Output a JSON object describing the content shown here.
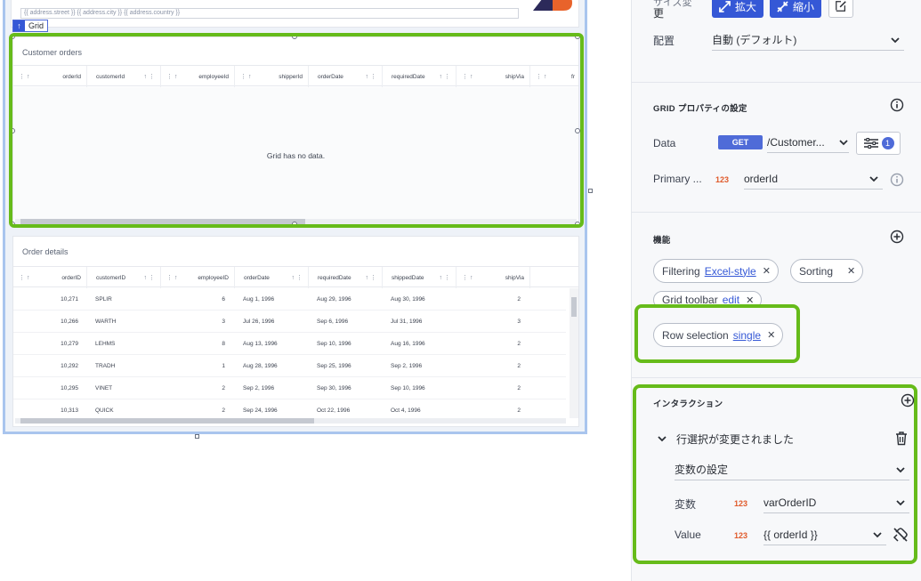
{
  "canvas": {
    "address_template": "{{ address.street }}   {{ address.city }}   {{ address.country }}",
    "grid_tag_label": "Grid",
    "customer_orders": {
      "title": "Customer orders",
      "columns": [
        "orderId",
        "customerId",
        "employeeId",
        "shipperId",
        "orderDate",
        "requiredDate",
        "shipVia",
        "fr"
      ],
      "empty_message": "Grid has no data."
    },
    "order_details": {
      "title": "Order details",
      "columns": [
        "orderID",
        "customerID",
        "employeeID",
        "orderDate",
        "requiredDate",
        "shippedDate",
        "shipVia"
      ],
      "rows": [
        {
          "orderID": "10,271",
          "customerID": "SPLIR",
          "employeeID": "6",
          "orderDate": "Aug 1, 1996",
          "requiredDate": "Aug 29, 1996",
          "shippedDate": "Aug 30, 1996",
          "shipVia": "2"
        },
        {
          "orderID": "10,266",
          "customerID": "WARTH",
          "employeeID": "3",
          "orderDate": "Jul 26, 1996",
          "requiredDate": "Sep 6, 1996",
          "shippedDate": "Jul 31, 1996",
          "shipVia": "3"
        },
        {
          "orderID": "10,279",
          "customerID": "LEHMS",
          "employeeID": "8",
          "orderDate": "Aug 13, 1996",
          "requiredDate": "Sep 10, 1996",
          "shippedDate": "Aug 16, 1996",
          "shipVia": "2"
        },
        {
          "orderID": "10,292",
          "customerID": "TRADH",
          "employeeID": "1",
          "orderDate": "Aug 28, 1996",
          "requiredDate": "Sep 25, 1996",
          "shippedDate": "Sep 2, 1996",
          "shipVia": "2"
        },
        {
          "orderID": "10,295",
          "customerID": "VINET",
          "employeeID": "2",
          "orderDate": "Sep 2, 1996",
          "requiredDate": "Sep 30, 1996",
          "shippedDate": "Sep 10, 1996",
          "shipVia": "2"
        },
        {
          "orderID": "10,313",
          "customerID": "QUICK",
          "employeeID": "2",
          "orderDate": "Sep 24, 1996",
          "requiredDate": "Oct 22, 1996",
          "shippedDate": "Oct 4, 1996",
          "shipVia": "2"
        }
      ]
    }
  },
  "panel": {
    "size_label": "更",
    "size_label_top": "サイズ変",
    "expand_label": "拡大",
    "shrink_label": "縮小",
    "placement_label": "配置",
    "placement_value": "自動 (デフォルト)",
    "grid_props_header": "GRID プロパティの設定",
    "data_label": "Data",
    "data_method": "GET",
    "data_value": "/Customer...",
    "filter_count": "1",
    "primary_label": "Primary ...",
    "primary_type": "123",
    "primary_value": "orderId",
    "features_header": "機能",
    "features": [
      {
        "name": "Filtering",
        "value": "Excel-style"
      },
      {
        "name": "Sorting",
        "value": ""
      },
      {
        "name": "Grid toolbar",
        "value": "edit"
      },
      {
        "name": "Row selection",
        "value": "single"
      }
    ],
    "interactions_header": "インタラクション",
    "event_label": "行選択が変更されました",
    "action_value": "変数の設定",
    "variable_label": "変数",
    "variable_type": "123",
    "variable_value": "varOrderID",
    "value_label": "Value",
    "value_type": "123",
    "value_value": "{{ orderId }}"
  },
  "colors": {
    "highlight_green": "#66bb1a",
    "primary_blue": "#3558d6",
    "number_badge": "#e05a2b"
  }
}
